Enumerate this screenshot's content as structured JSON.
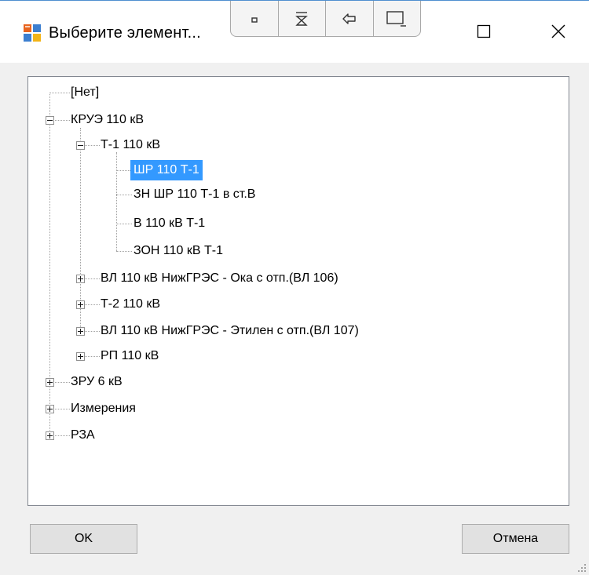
{
  "window": {
    "title": "Выберите элемент..."
  },
  "title_bar_extra_buttons": [
    "restore-small-icon",
    "pin-icon",
    "back-icon",
    "window-icon"
  ],
  "window_controls": [
    "maximize-icon",
    "close-icon"
  ],
  "tree": {
    "nodes": [
      {
        "label": "[Нет]",
        "level": 0,
        "expander": "none"
      },
      {
        "label": "КРУЭ 110 кВ",
        "level": 0,
        "expander": "expanded"
      },
      {
        "label": "Т-1 110 кВ",
        "level": 1,
        "expander": "expanded"
      },
      {
        "label": "ШР 110 Т-1",
        "level": 2,
        "expander": "none",
        "selected": true
      },
      {
        "label": "ЗН ШР 110 Т-1 в ст.В",
        "level": 2,
        "expander": "none"
      },
      {
        "label": "В 110 кВ Т-1",
        "level": 2,
        "expander": "none"
      },
      {
        "label": "ЗОН 110 кВ Т-1",
        "level": 2,
        "expander": "none"
      },
      {
        "label": "ВЛ 110 кВ НижГРЭС - Ока с отп.(ВЛ 106)",
        "level": 1,
        "expander": "collapsed"
      },
      {
        "label": "Т-2 110 кВ",
        "level": 1,
        "expander": "collapsed"
      },
      {
        "label": "ВЛ 110 кВ НижГРЭС - Этилен с отп.(ВЛ 107)",
        "level": 1,
        "expander": "collapsed"
      },
      {
        "label": "РП 110 кВ",
        "level": 1,
        "expander": "collapsed"
      },
      {
        "label": "ЗРУ 6 кВ",
        "level": 0,
        "expander": "collapsed"
      },
      {
        "label": "Измерения",
        "level": 0,
        "expander": "collapsed"
      },
      {
        "label": "РЗА",
        "level": 0,
        "expander": "collapsed"
      }
    ]
  },
  "buttons": {
    "ok": "OK",
    "cancel": "Отмена"
  },
  "colors": {
    "selection": "#3399ff",
    "window_background": "#f0f0f0",
    "title_border": "#4f8fd0"
  }
}
